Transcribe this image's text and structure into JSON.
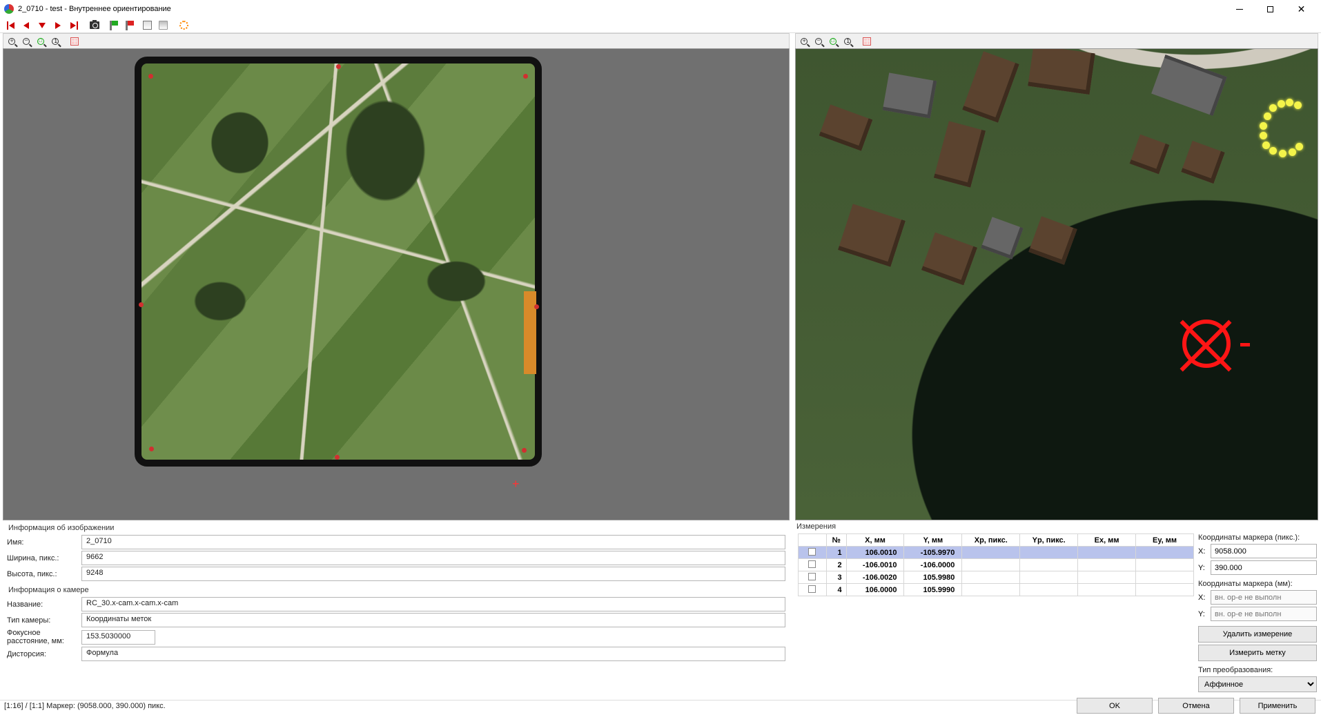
{
  "window": {
    "title": "2_0710 - test - Внутреннее ориентирование"
  },
  "image_info": {
    "section_title": "Информация об изображении",
    "name_label": "Имя:",
    "name_value": "2_0710",
    "width_label": "Ширина, пикс.:",
    "width_value": "9662",
    "height_label": "Высота, пикс.:",
    "height_value": "9248"
  },
  "camera_info": {
    "section_title": "Информация о камере",
    "name_label": "Название:",
    "name_value": "RC_30.x-cam.x-cam.x-cam",
    "type_label": "Тип камеры:",
    "type_value": "Координаты меток",
    "focal_label": "Фокусное расстояние, мм:",
    "focal_value": "153.5030000",
    "dist_label": "Дисторсия:",
    "dist_value": "Формула"
  },
  "measurements": {
    "section_title": "Измерения",
    "headers": {
      "n": "№",
      "x": "X, мм",
      "y": "Y, мм",
      "xp": "Xр, пикс.",
      "yp": "Yр, пикс.",
      "ex": "Ex, мм",
      "ey": "Ey, мм"
    },
    "rows": [
      {
        "n": "1",
        "x": "106.0010",
        "y": "-105.9970",
        "xp": "",
        "yp": "",
        "ex": "",
        "ey": ""
      },
      {
        "n": "2",
        "x": "-106.0010",
        "y": "-106.0000",
        "xp": "",
        "yp": "",
        "ex": "",
        "ey": ""
      },
      {
        "n": "3",
        "x": "-106.0020",
        "y": "105.9980",
        "xp": "",
        "yp": "",
        "ex": "",
        "ey": ""
      },
      {
        "n": "4",
        "x": "106.0000",
        "y": "105.9990",
        "xp": "",
        "yp": "",
        "ex": "",
        "ey": ""
      }
    ]
  },
  "marker_panel": {
    "px_title": "Координаты маркера (пикс.):",
    "x_label": "X:",
    "y_label": "Y:",
    "px_x": "9058.000",
    "px_y": "390.000",
    "mm_title": "Координаты маркера (мм):",
    "mm_placeholder": "вн. ор-е не выполн",
    "btn_delete": "Удалить измерение",
    "btn_measure": "Измерить метку",
    "transform_title": "Тип преобразования:",
    "transform_value": "Аффинное"
  },
  "dialog": {
    "ok": "OK",
    "cancel": "Отмена",
    "apply": "Применить"
  },
  "status": {
    "text": "[1:16]  /  [1:1]  Маркер: (9058.000, 390.000) пикс."
  }
}
